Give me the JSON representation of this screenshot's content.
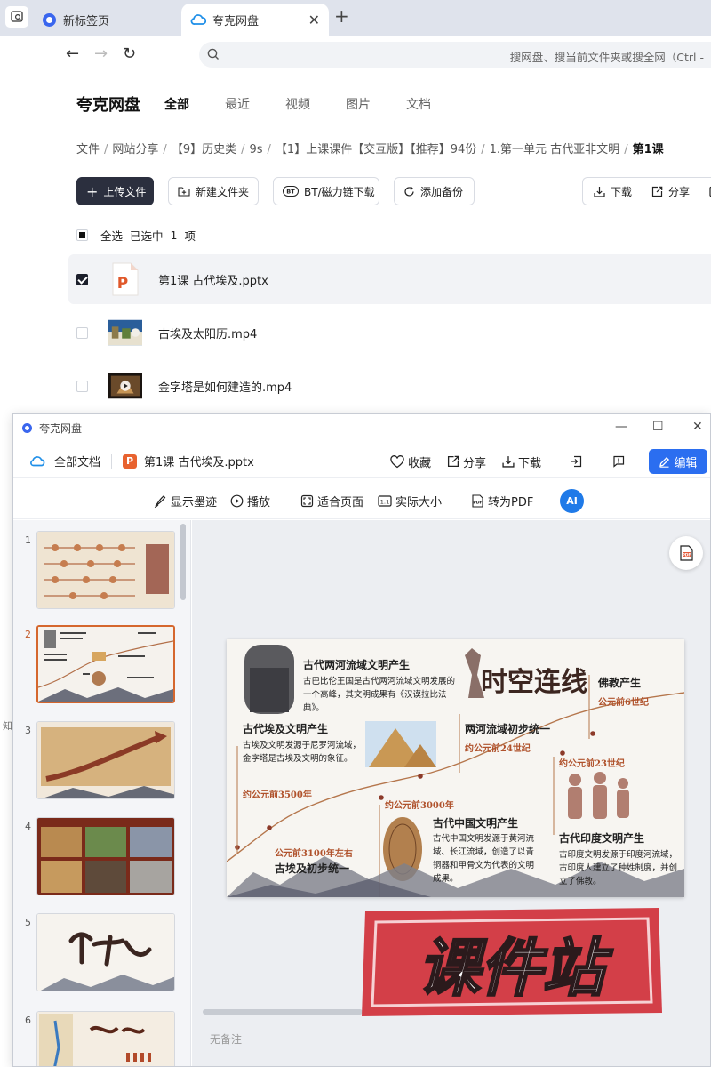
{
  "browser": {
    "tabs": [
      {
        "label": "新标签页",
        "active": false
      },
      {
        "label": "夸克网盘",
        "active": true
      }
    ],
    "address_placeholder": "搜网盘、搜当前文件夹或搜全网（Ctrl -"
  },
  "drive": {
    "brand": "夸克网盘",
    "nav": [
      "全部",
      "最近",
      "视频",
      "图片",
      "文档"
    ],
    "breadcrumbs": [
      "文件",
      "网站分享",
      "【9】历史类",
      "9s",
      "【1】上课课件【交互版】【推荐】94份",
      "1.第一单元 古代亚非文明",
      "第1课"
    ],
    "toolbar": {
      "upload": "上传文件",
      "new_folder": "新建文件夹",
      "bt": "BT/磁力链下载",
      "backup": "添加备份",
      "download": "下载",
      "share": "分享"
    },
    "select_all": "全选",
    "selected_prefix": "已选中",
    "selected_count": "1",
    "selected_unit": "项",
    "files": [
      {
        "name": "第1课 古代埃及.pptx",
        "type": "pptx",
        "checked": true
      },
      {
        "name": "古埃及太阳历.mp4",
        "type": "video",
        "checked": false
      },
      {
        "name": "金字塔是如何建造的.mp4",
        "type": "video",
        "checked": false
      }
    ],
    "edge_label": "知"
  },
  "viewer": {
    "window_title": "夸克网盘",
    "all_docs": "全部文档",
    "doc_name": "第1课 古代埃及.pptx",
    "actions": {
      "favorite": "收藏",
      "share": "分享",
      "download": "下载",
      "edit": "编辑"
    },
    "view_bar": {
      "ink": "显示墨迹",
      "play": "播放",
      "fit": "适合页面",
      "actual": "实际大小",
      "to_pdf": "转为PDF",
      "ai": "AI"
    },
    "slides": [
      {
        "num": "1",
        "active": false
      },
      {
        "num": "2",
        "active": true
      },
      {
        "num": "3",
        "active": false
      },
      {
        "num": "4",
        "active": false
      },
      {
        "num": "5",
        "active": false
      },
      {
        "num": "6",
        "active": false
      }
    ],
    "notes": "无备注",
    "slide": {
      "title_art": "时空连线",
      "items": [
        {
          "heading": "古代两河流域文明产生",
          "body": "古巴比伦王国是古代两河流域文明发展的一个高峰，其文明成果有《汉谟拉比法典》。"
        },
        {
          "heading": "古代埃及文明产生",
          "body": "古埃及文明发源于尼罗河流域，金字塔是古埃及文明的象征。",
          "date": "约公元前3500年"
        },
        {
          "heading": "两河流域初步统一",
          "date": "约公元前24世纪"
        },
        {
          "heading": "佛教产生",
          "date": "公元前6世纪"
        },
        {
          "date": "约公元前23世纪"
        },
        {
          "date": "约公元前3000年"
        },
        {
          "heading": "古代中国文明产生",
          "body": "古代中国文明发源于黄河流域、长江流域，创造了以青铜器和甲骨文为代表的文明成果。"
        },
        {
          "heading": "古代印度文明产生",
          "body": "古印度文明发源于印度河流域，古印度人建立了种姓制度，并创立了佛教。"
        },
        {
          "heading": "古埃及初步统一",
          "date": "公元前3100年左右"
        }
      ]
    }
  },
  "watermark": "课件站"
}
